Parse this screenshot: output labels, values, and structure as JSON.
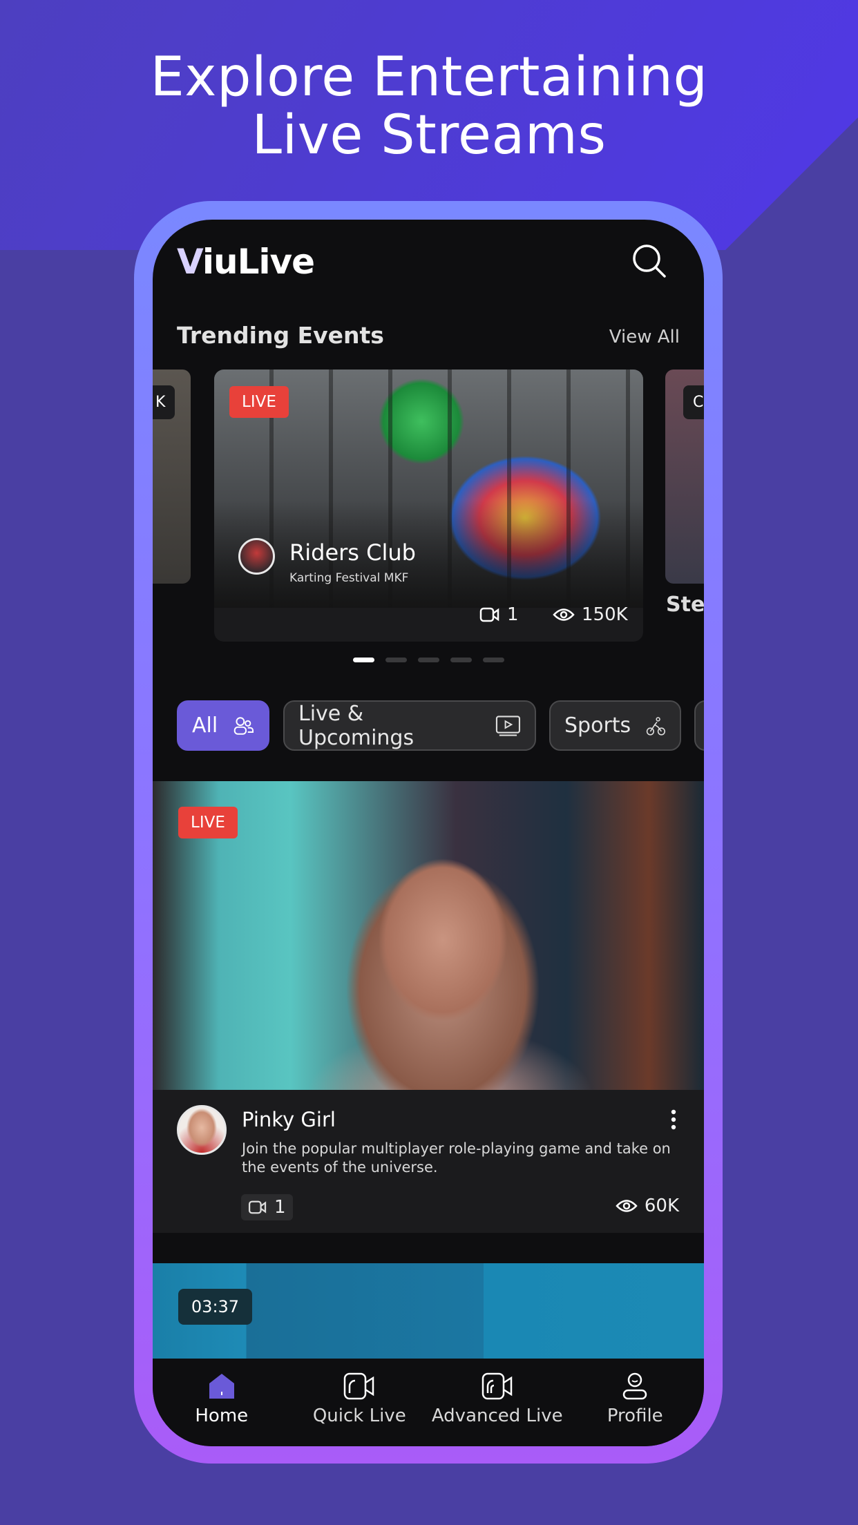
{
  "headline": {
    "line1": "Explore Entertaining",
    "line2": "Live Streams"
  },
  "app": {
    "logo": "ViuLive",
    "logo_v": "V",
    "logo_rest": "iuLive"
  },
  "trending": {
    "title": "Trending Events",
    "view_all": "View All",
    "prev_card_badge": "K",
    "next_card_badge": "C",
    "next_card_title": "Step",
    "card": {
      "badge": "LIVE",
      "title": "Riders Club",
      "subtitle": "Karting Festival MKF",
      "cameras": "1",
      "views": "150K"
    },
    "pages": 5,
    "active_page": 1
  },
  "categories": [
    {
      "label": "All",
      "icon": "users-icon",
      "active": true
    },
    {
      "label": "Live & Upcomings",
      "icon": "play-screen-icon",
      "active": false
    },
    {
      "label": "Sports",
      "icon": "cyclist-icon",
      "active": false
    }
  ],
  "feed": [
    {
      "badge": "LIVE",
      "name": "Pinky Girl",
      "description": "Join the popular multiplayer role-playing game and take on the events of the universe.",
      "cameras": "1",
      "views": "60K"
    },
    {
      "duration": "03:37"
    }
  ],
  "nav": [
    {
      "label": "Home",
      "icon": "home-icon",
      "active": true
    },
    {
      "label": "Quick Live",
      "icon": "video-camera-icon"
    },
    {
      "label": "Advanced Live",
      "icon": "broadcast-camera-icon"
    },
    {
      "label": "Profile",
      "icon": "profile-icon"
    }
  ],
  "colors": {
    "accent": "#6a5ad8",
    "live": "#e8413a",
    "background": "#4a3fa3"
  }
}
